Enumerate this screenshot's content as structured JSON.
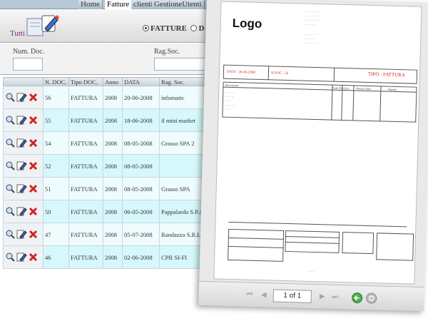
{
  "tabs": [
    {
      "label": "Home"
    },
    {
      "label": "Fatture"
    },
    {
      "label": "clienti"
    },
    {
      "label": "GestioneUtenti"
    }
  ],
  "toolbar": {
    "tutti_label": "Tutti",
    "radio_fatture": "FATTURE",
    "radio_other": "D"
  },
  "filters": {
    "num_doc_label": "Num. Doc.",
    "rag_soc_label": "Rag.Soc."
  },
  "grid": {
    "headers": [
      "N. DOC.",
      "Tipo DOC.",
      "Anno",
      "DATA",
      "Rag. Soc."
    ],
    "rows": [
      [
        "56",
        "FATTURA",
        "2008",
        "20-06-2008",
        "infomatic"
      ],
      [
        "55",
        "FATTURA",
        "2008",
        "18-06-2008",
        "il mini market"
      ],
      [
        "54",
        "FATTURA",
        "2008",
        "08-05-2008",
        "Grasso SPA 2"
      ],
      [
        "52",
        "FATTURA",
        "2008",
        "08-05-2008",
        ""
      ],
      [
        "51",
        "FATTURA",
        "2008",
        "08-05-2008",
        "Grasso SPA"
      ],
      [
        "50",
        "FATTURA",
        "2008",
        "06-05-2008",
        "Pappalardo S.P.A."
      ],
      [
        "47",
        "FATTURA",
        "2008",
        "05-07-2008",
        "Randazzo S.R.L."
      ],
      [
        "46",
        "FATTURA",
        "2008",
        "02-06-2008",
        "CPR SI-FI"
      ]
    ]
  },
  "document": {
    "logo": "Logo",
    "date_text": "DATA : 20-06-2008",
    "ndoc_text": "N.DOC : 56",
    "tipo_text": "TIPO : FATTURA",
    "table_headers": [
      "Descrizione",
      "Cod. IVA",
      "Q.tà",
      "Prezzo Unità",
      "Importo"
    ],
    "sender_lines": [
      "·· ·· ·· · ·· ··",
      "·· ·· · ··· ·· ·",
      "·· ·· ·· ··· · ··",
      "·· ·· ·· ··"
    ],
    "recipient_lines": [
      "·· ·· ··· · ··",
      "·· ·· · ·· ··",
      "·· ·· ··· · ·· ·"
    ],
    "item_lines": [
      "·· ·· ·· ·",
      "·· ·· · ··",
      "·· ·· ··",
      "·· ·· · ·· ·",
      "·· ··"
    ],
    "footer_caption": "·· ·· ··",
    "page_label": "1 of 1"
  },
  "colors": {
    "accent_red": "#d62020",
    "row_odd": "#eefcfe",
    "row_even": "#d6f7fb",
    "nav_green": "#4caf50"
  }
}
